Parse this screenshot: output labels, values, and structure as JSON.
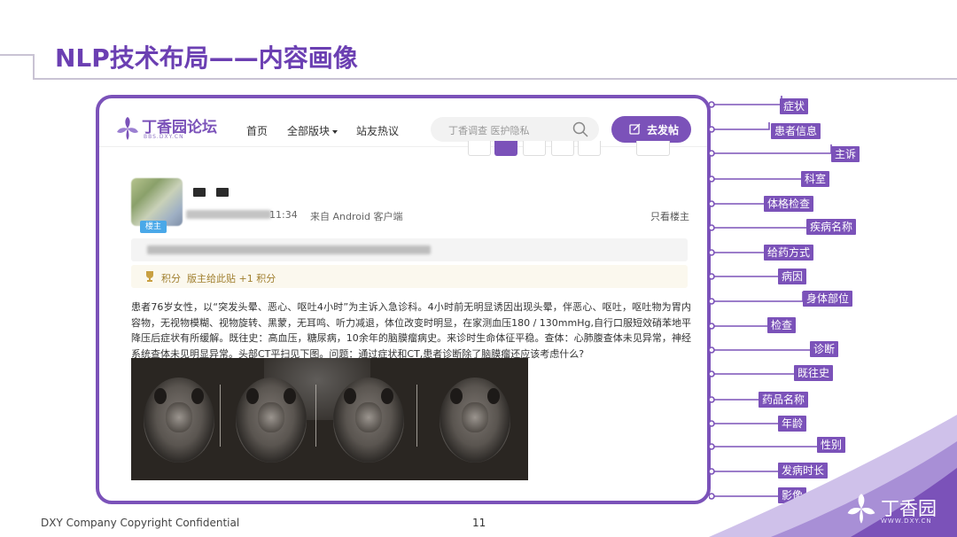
{
  "slide": {
    "title": "NLP技术布局——内容画像",
    "footer": "DXY Company Copyright Confidential",
    "page_number": "11",
    "corner_logo": "丁香园",
    "corner_logo_sub": "WWW.DXY.CN"
  },
  "forum": {
    "logo_text": "丁香园论坛",
    "logo_sub": "BBS.DXY.CN",
    "nav": [
      "首页",
      "全部版块",
      "站友热议"
    ],
    "search_placeholder": "丁香调查 医护隐私",
    "post_button": "去发帖",
    "post": {
      "badge": "楼主",
      "time": "11:34",
      "source": "来自 Android 客户端",
      "only_op": "只看楼主",
      "score_label": "积分",
      "score_text": "版主给此贴 +1 积分",
      "body": "患者76岁女性，以“突发头晕、恶心、呕吐4小时”为主诉入急诊科。4小时前无明显诱因出现头晕，伴恶心、呕吐，呕吐物为胃内容物，无视物模糊、视物旋转、黑蒙，无耳鸣、听力减退，体位改变时明显，在家测血压180 / 130mmHg,自行口服短效硝苯地平降压后症状有所缓解。既往史：高血压，糖尿病，10余年的脑膜瘤病史。来诊时生命体征平稳。查体：心肺腹查体未见异常，神经系统查体未见明显异常。头部CT平扫见下图。问题：通过症状和CT,患者诊断除了脑膜瘤还应该考虑什么?"
    }
  },
  "entity_labels": [
    "症状",
    "患者信息",
    "主诉",
    "科室",
    "体格检查",
    "疾病名称",
    "给药方式",
    "病因",
    "身体部位",
    "检查",
    "诊断",
    "既往史",
    "药品名称",
    "年龄",
    "性别",
    "发病时长",
    "影像"
  ],
  "colors": {
    "accent": "#7b52b9",
    "title": "#6b3fb2"
  }
}
